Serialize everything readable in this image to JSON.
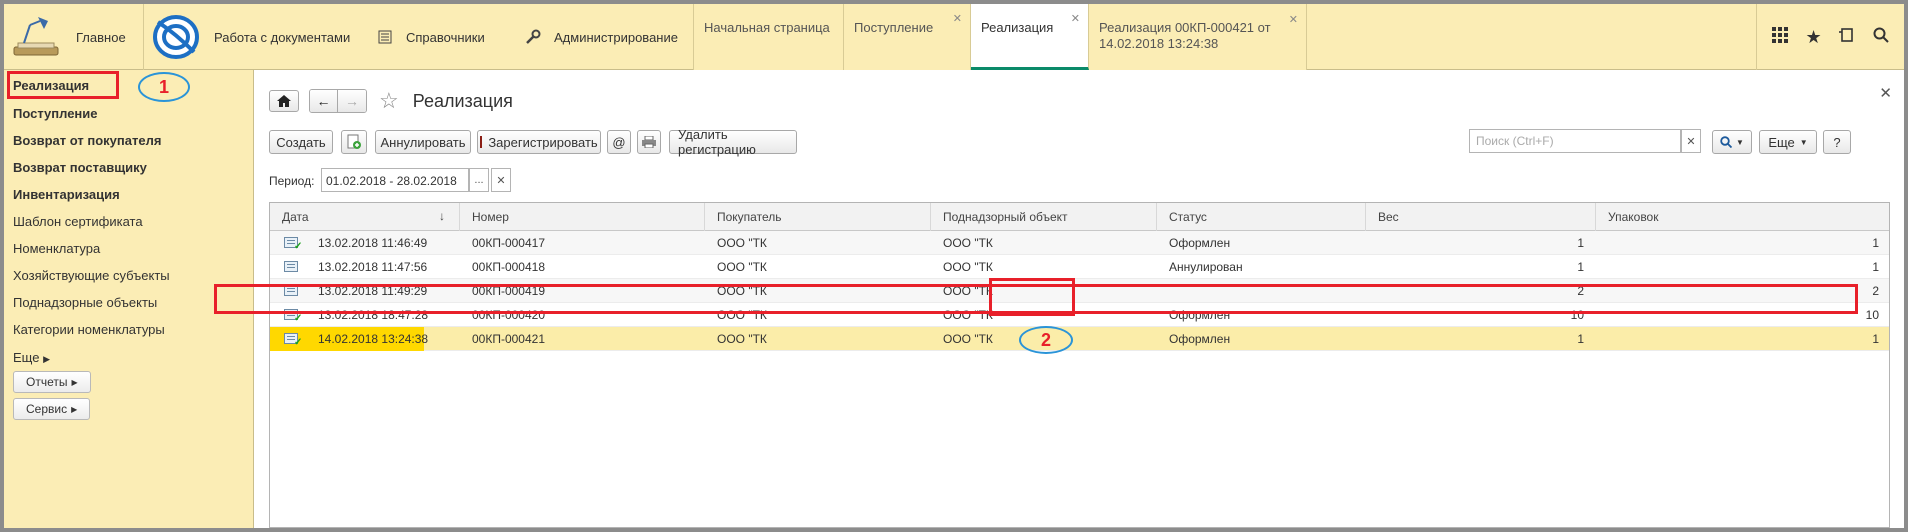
{
  "topbar": {
    "home_label": "Главное",
    "sections": [
      {
        "label": "Работа с документами",
        "icon": "1c-logo-icon"
      },
      {
        "label": "Справочники",
        "icon": "list-icon"
      },
      {
        "label": "Администрирование",
        "icon": "wrench-icon"
      }
    ],
    "tabs": [
      {
        "label": "Начальная страница"
      },
      {
        "label": "Поступление"
      },
      {
        "label": "Реализация"
      },
      {
        "label_line1": "Реализация 00КП-000421 от",
        "label_line2": "14.02.2018 13:24:38"
      }
    ],
    "right_icons": [
      "apps-grid-icon",
      "star-icon",
      "history-icon",
      "search-icon"
    ]
  },
  "sidebar": {
    "items": [
      {
        "label": "Реализация",
        "bold": true
      },
      {
        "label": "Поступление",
        "bold": true
      },
      {
        "label": "Возврат от покупателя",
        "bold": true
      },
      {
        "label": "Возврат поставщику",
        "bold": true
      },
      {
        "label": "Инвентаризация",
        "bold": true
      },
      {
        "label": "Шаблон сертификата",
        "bold": false
      },
      {
        "label": "Номенклатура",
        "bold": false
      },
      {
        "label": "Хозяйствующие субъекты",
        "bold": false
      },
      {
        "label": "Поднадзорные объекты",
        "bold": false
      },
      {
        "label": "Категории номенклатуры",
        "bold": false
      }
    ],
    "more_label": "Еще",
    "reports_label": "Отчеты",
    "service_label": "Сервис"
  },
  "form": {
    "title": "Реализация",
    "buttons": {
      "create": "Создать",
      "annul": "Аннулировать",
      "register": "Зарегистрировать",
      "at": "@",
      "delete_reg": "Удалить регистрацию",
      "more": "Еще",
      "help": "?"
    },
    "search_placeholder": "Поиск (Ctrl+F)",
    "period_label": "Период:",
    "period_value": "01.02.2018 - 28.02.2018"
  },
  "table": {
    "columns": [
      "Дата",
      "Номер",
      "Покупатель",
      "Поднадзорный объект",
      "Статус",
      "Вес",
      "Упаковок"
    ],
    "sort_indicator": "↓",
    "rows": [
      {
        "date": "13.02.2018 11:46:49",
        "number": "00КП-000417",
        "buyer": "ООО \"ТК",
        "object": "ООО \"ТК",
        "status": "Оформлен",
        "weight": "1",
        "packs": "1",
        "icon": "doc-ok-icon"
      },
      {
        "date": "13.02.2018 11:47:56",
        "number": "00КП-000418",
        "buyer": "ООО \"ТК",
        "object": "ООО \"ТК",
        "status": "Аннулирован",
        "weight": "1",
        "packs": "1",
        "icon": "doc-icon"
      },
      {
        "date": "13.02.2018 11:49:29",
        "number": "00КП-000419",
        "buyer": "ООО \"ТК",
        "object": "ООО \"ТК",
        "status": "",
        "weight": "2",
        "packs": "2",
        "icon": "doc-icon"
      },
      {
        "date": "13.02.2018 18:47:28",
        "number": "00КП-000420",
        "buyer": "ООО \"ТК",
        "object": "ООО \"ТК",
        "status": "Оформлен",
        "weight": "10",
        "packs": "10",
        "icon": "doc-ok-icon"
      },
      {
        "date": "14.02.2018 13:24:38",
        "number": "00КП-000421",
        "buyer": "ООО \"ТК",
        "object": "ООО \"ТК",
        "status": "Оформлен",
        "weight": "1",
        "packs": "1",
        "icon": "doc-ok-icon"
      }
    ]
  },
  "annotations": {
    "marker1": "1",
    "marker2": "2"
  }
}
